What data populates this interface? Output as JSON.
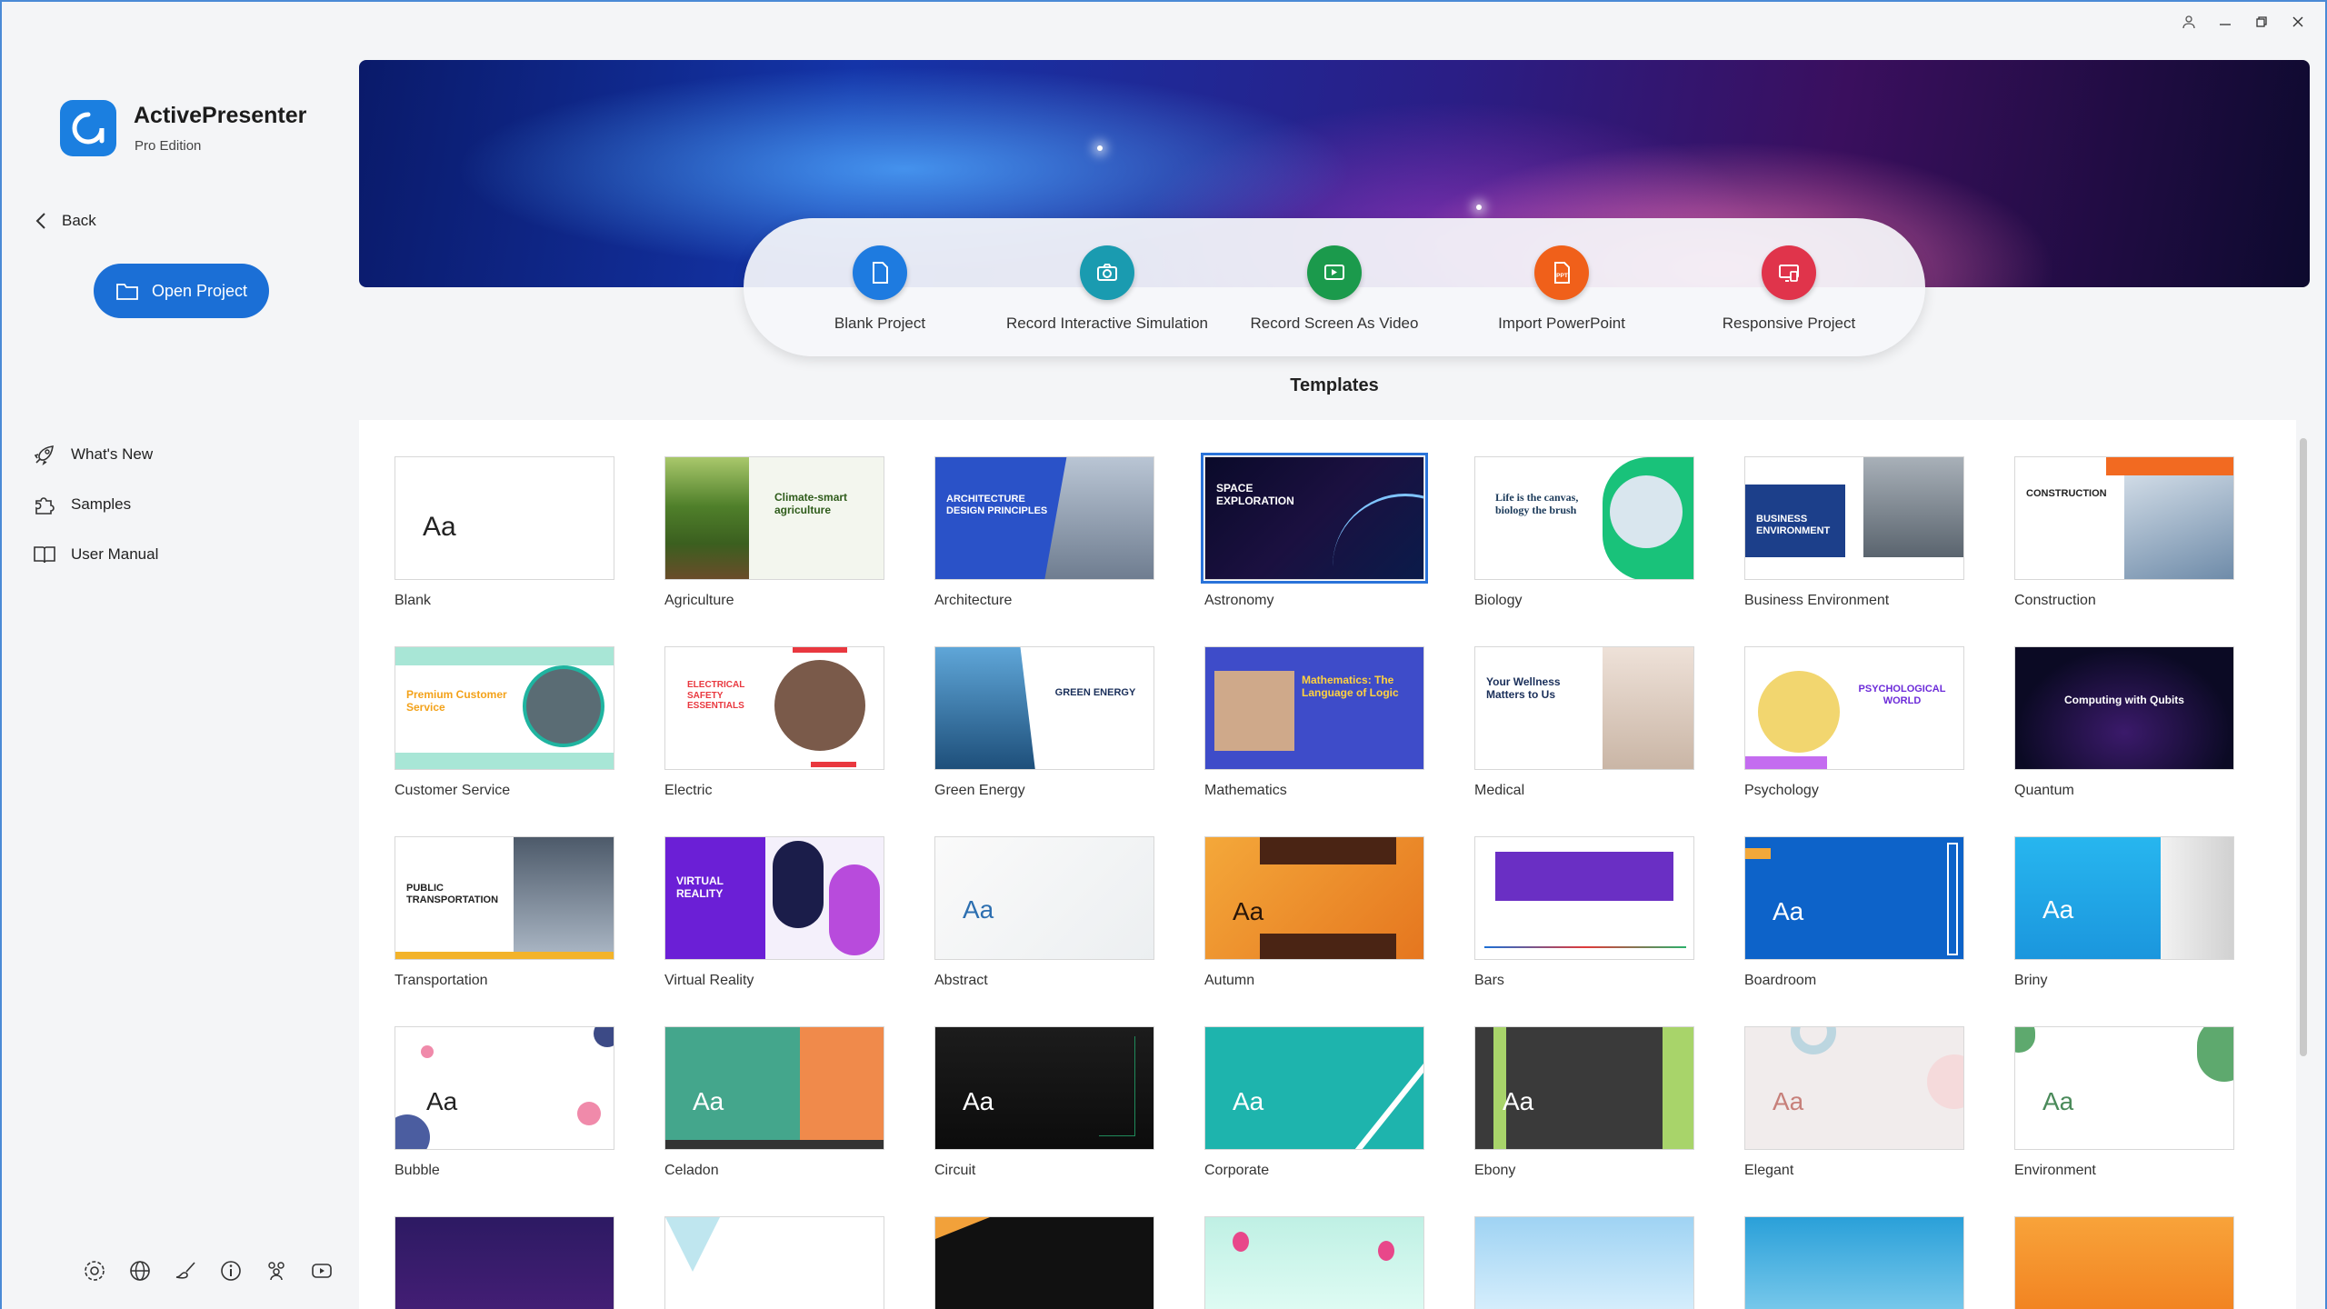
{
  "window": {
    "controls": [
      "user-icon",
      "minimize-icon",
      "restore-icon",
      "close-icon"
    ]
  },
  "app": {
    "name": "ActivePresenter",
    "edition": "Pro Edition"
  },
  "nav": {
    "back_label": "Back",
    "open_project_label": "Open Project"
  },
  "side_links": [
    {
      "label": "What's New",
      "icon": "rocket-icon"
    },
    {
      "label": "Samples",
      "icon": "puzzle-icon"
    },
    {
      "label": "User Manual",
      "icon": "book-icon"
    }
  ],
  "bottom_icons": [
    "settings-icon",
    "globe-icon",
    "brush-icon",
    "info-icon",
    "community-icon",
    "youtube-icon"
  ],
  "actions": [
    {
      "label": "Blank Project",
      "color": "#1e7be0",
      "icon": "blank-document-icon"
    },
    {
      "label": "Record Interactive Simulation",
      "color": "#1a9bb0",
      "icon": "camera-icon"
    },
    {
      "label": "Record Screen As Video",
      "color": "#1b9a4c",
      "icon": "video-record-icon"
    },
    {
      "label": "Import PowerPoint",
      "color": "#f0601a",
      "icon": "powerpoint-icon"
    },
    {
      "label": "Responsive Project",
      "color": "#e0344b",
      "icon": "responsive-icon"
    }
  ],
  "templates": {
    "title": "Templates",
    "items": [
      {
        "name": "Blank"
      },
      {
        "name": "Agriculture",
        "thumb_text": "Climate-smart agriculture"
      },
      {
        "name": "Architecture",
        "thumb_text": "ARCHITECTURE DESIGN PRINCIPLES"
      },
      {
        "name": "Astronomy",
        "thumb_text": "SPACE EXPLORATION"
      },
      {
        "name": "Biology",
        "thumb_text": "Life is the canvas, biology the brush"
      },
      {
        "name": "Business Environment",
        "thumb_text": "BUSINESS ENVIRONMENT"
      },
      {
        "name": "Construction",
        "thumb_text": "CONSTRUCTION"
      },
      {
        "name": "Customer Service",
        "thumb_text": "Premium Customer Service"
      },
      {
        "name": "Electric",
        "thumb_text": "ELECTRICAL SAFETY ESSENTIALS"
      },
      {
        "name": "Green Energy",
        "thumb_text": "GREEN ENERGY"
      },
      {
        "name": "Mathematics",
        "thumb_text": "Mathematics: The Language of Logic"
      },
      {
        "name": "Medical",
        "thumb_text": "Your Wellness Matters to Us"
      },
      {
        "name": "Psychology",
        "thumb_text": "PSYCHOLOGICAL WORLD"
      },
      {
        "name": "Quantum",
        "thumb_text": "Computing with Qubits"
      },
      {
        "name": "Transportation",
        "thumb_text": "PUBLIC TRANSPORTATION"
      },
      {
        "name": "Virtual Reality",
        "thumb_text": "VIRTUAL REALITY"
      },
      {
        "name": "Abstract"
      },
      {
        "name": "Autumn"
      },
      {
        "name": "Bars"
      },
      {
        "name": "Boardroom"
      },
      {
        "name": "Briny"
      },
      {
        "name": "Bubble"
      },
      {
        "name": "Celadon"
      },
      {
        "name": "Circuit"
      },
      {
        "name": "Corporate"
      },
      {
        "name": "Ebony"
      },
      {
        "name": "Elegant"
      },
      {
        "name": "Environment"
      },
      {
        "name": ""
      },
      {
        "name": ""
      },
      {
        "name": ""
      },
      {
        "name": ""
      },
      {
        "name": ""
      },
      {
        "name": ""
      },
      {
        "name": ""
      }
    ],
    "aa_label": "Aa",
    "selected": "Astronomy"
  }
}
